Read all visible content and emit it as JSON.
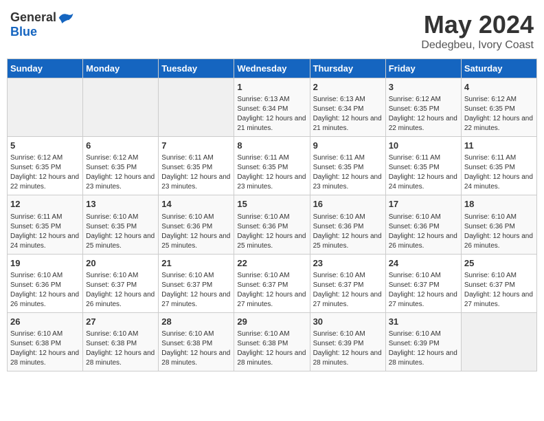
{
  "header": {
    "logo_general": "General",
    "logo_blue": "Blue",
    "title": "May 2024",
    "subtitle": "Dedegbeu, Ivory Coast"
  },
  "weekdays": [
    "Sunday",
    "Monday",
    "Tuesday",
    "Wednesday",
    "Thursday",
    "Friday",
    "Saturday"
  ],
  "weeks": [
    [
      {
        "day": "",
        "info": ""
      },
      {
        "day": "",
        "info": ""
      },
      {
        "day": "",
        "info": ""
      },
      {
        "day": "1",
        "info": "Sunrise: 6:13 AM\nSunset: 6:34 PM\nDaylight: 12 hours and 21 minutes."
      },
      {
        "day": "2",
        "info": "Sunrise: 6:13 AM\nSunset: 6:34 PM\nDaylight: 12 hours and 21 minutes."
      },
      {
        "day": "3",
        "info": "Sunrise: 6:12 AM\nSunset: 6:35 PM\nDaylight: 12 hours and 22 minutes."
      },
      {
        "day": "4",
        "info": "Sunrise: 6:12 AM\nSunset: 6:35 PM\nDaylight: 12 hours and 22 minutes."
      }
    ],
    [
      {
        "day": "5",
        "info": "Sunrise: 6:12 AM\nSunset: 6:35 PM\nDaylight: 12 hours and 22 minutes."
      },
      {
        "day": "6",
        "info": "Sunrise: 6:12 AM\nSunset: 6:35 PM\nDaylight: 12 hours and 23 minutes."
      },
      {
        "day": "7",
        "info": "Sunrise: 6:11 AM\nSunset: 6:35 PM\nDaylight: 12 hours and 23 minutes."
      },
      {
        "day": "8",
        "info": "Sunrise: 6:11 AM\nSunset: 6:35 PM\nDaylight: 12 hours and 23 minutes."
      },
      {
        "day": "9",
        "info": "Sunrise: 6:11 AM\nSunset: 6:35 PM\nDaylight: 12 hours and 23 minutes."
      },
      {
        "day": "10",
        "info": "Sunrise: 6:11 AM\nSunset: 6:35 PM\nDaylight: 12 hours and 24 minutes."
      },
      {
        "day": "11",
        "info": "Sunrise: 6:11 AM\nSunset: 6:35 PM\nDaylight: 12 hours and 24 minutes."
      }
    ],
    [
      {
        "day": "12",
        "info": "Sunrise: 6:11 AM\nSunset: 6:35 PM\nDaylight: 12 hours and 24 minutes."
      },
      {
        "day": "13",
        "info": "Sunrise: 6:10 AM\nSunset: 6:35 PM\nDaylight: 12 hours and 25 minutes."
      },
      {
        "day": "14",
        "info": "Sunrise: 6:10 AM\nSunset: 6:36 PM\nDaylight: 12 hours and 25 minutes."
      },
      {
        "day": "15",
        "info": "Sunrise: 6:10 AM\nSunset: 6:36 PM\nDaylight: 12 hours and 25 minutes."
      },
      {
        "day": "16",
        "info": "Sunrise: 6:10 AM\nSunset: 6:36 PM\nDaylight: 12 hours and 25 minutes."
      },
      {
        "day": "17",
        "info": "Sunrise: 6:10 AM\nSunset: 6:36 PM\nDaylight: 12 hours and 26 minutes."
      },
      {
        "day": "18",
        "info": "Sunrise: 6:10 AM\nSunset: 6:36 PM\nDaylight: 12 hours and 26 minutes."
      }
    ],
    [
      {
        "day": "19",
        "info": "Sunrise: 6:10 AM\nSunset: 6:36 PM\nDaylight: 12 hours and 26 minutes."
      },
      {
        "day": "20",
        "info": "Sunrise: 6:10 AM\nSunset: 6:37 PM\nDaylight: 12 hours and 26 minutes."
      },
      {
        "day": "21",
        "info": "Sunrise: 6:10 AM\nSunset: 6:37 PM\nDaylight: 12 hours and 27 minutes."
      },
      {
        "day": "22",
        "info": "Sunrise: 6:10 AM\nSunset: 6:37 PM\nDaylight: 12 hours and 27 minutes."
      },
      {
        "day": "23",
        "info": "Sunrise: 6:10 AM\nSunset: 6:37 PM\nDaylight: 12 hours and 27 minutes."
      },
      {
        "day": "24",
        "info": "Sunrise: 6:10 AM\nSunset: 6:37 PM\nDaylight: 12 hours and 27 minutes."
      },
      {
        "day": "25",
        "info": "Sunrise: 6:10 AM\nSunset: 6:37 PM\nDaylight: 12 hours and 27 minutes."
      }
    ],
    [
      {
        "day": "26",
        "info": "Sunrise: 6:10 AM\nSunset: 6:38 PM\nDaylight: 12 hours and 28 minutes."
      },
      {
        "day": "27",
        "info": "Sunrise: 6:10 AM\nSunset: 6:38 PM\nDaylight: 12 hours and 28 minutes."
      },
      {
        "day": "28",
        "info": "Sunrise: 6:10 AM\nSunset: 6:38 PM\nDaylight: 12 hours and 28 minutes."
      },
      {
        "day": "29",
        "info": "Sunrise: 6:10 AM\nSunset: 6:38 PM\nDaylight: 12 hours and 28 minutes."
      },
      {
        "day": "30",
        "info": "Sunrise: 6:10 AM\nSunset: 6:39 PM\nDaylight: 12 hours and 28 minutes."
      },
      {
        "day": "31",
        "info": "Sunrise: 6:10 AM\nSunset: 6:39 PM\nDaylight: 12 hours and 28 minutes."
      },
      {
        "day": "",
        "info": ""
      }
    ]
  ]
}
